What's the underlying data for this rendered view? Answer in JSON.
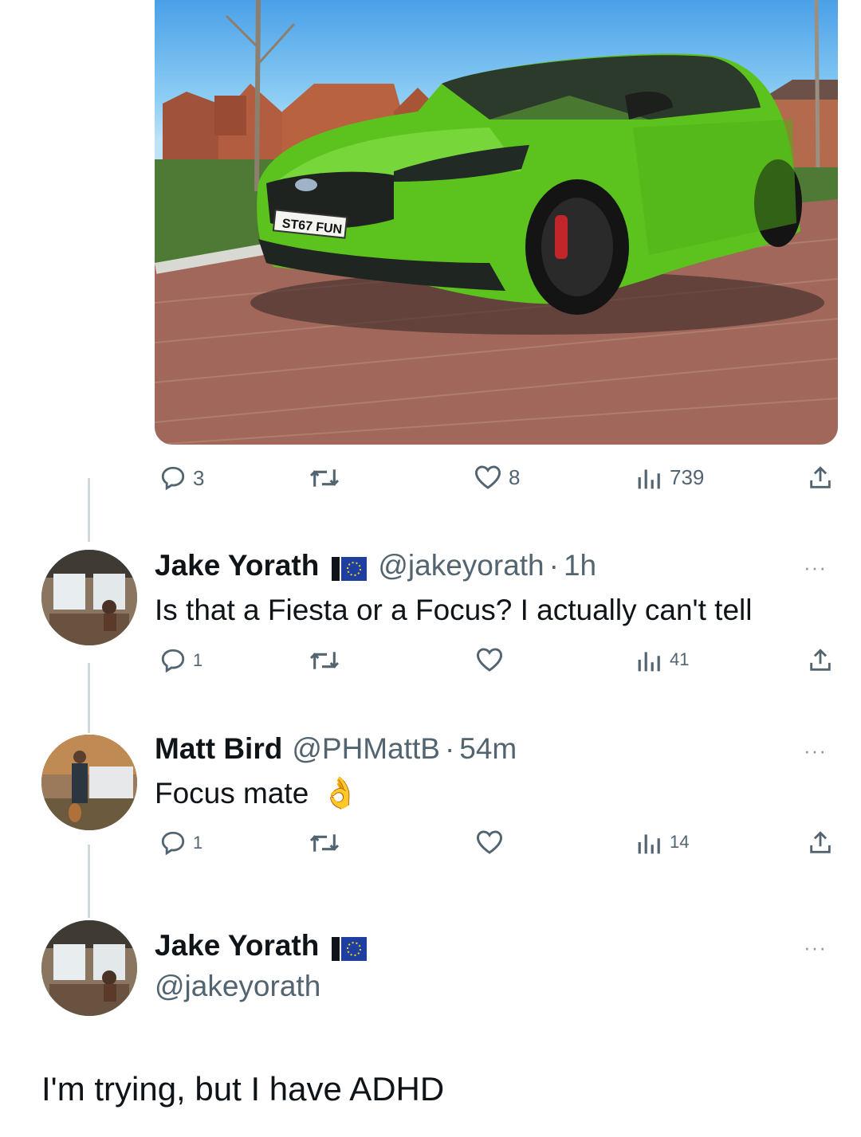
{
  "post": {
    "image_alt": "Green hatchback on a brick driveway",
    "plate": "ST67 FUN",
    "stats": {
      "replies": "3",
      "likes": "8",
      "views": "739"
    }
  },
  "replies": [
    {
      "name": "Jake Yorath",
      "handle": "@jakeyorath",
      "dot": "·",
      "time": "1h",
      "text": "Is that a Fiesta or a Focus? I actually can't tell",
      "stats": {
        "replies": "1",
        "views": "41"
      }
    },
    {
      "name": "Matt Bird",
      "handle": "@PHMattB",
      "dot": "·",
      "time": "54m",
      "text": "Focus mate",
      "emoji": "👌",
      "stats": {
        "replies": "1",
        "views": "14"
      }
    },
    {
      "name": "Jake Yorath",
      "handle": "@jakeyorath"
    }
  ],
  "more_label": "···",
  "caption": "I'm trying, but I have ADHD",
  "colors": {
    "text": "#0f1419",
    "muted": "#536471",
    "thread_line": "#cfd9de",
    "car": "#5cc21e"
  }
}
